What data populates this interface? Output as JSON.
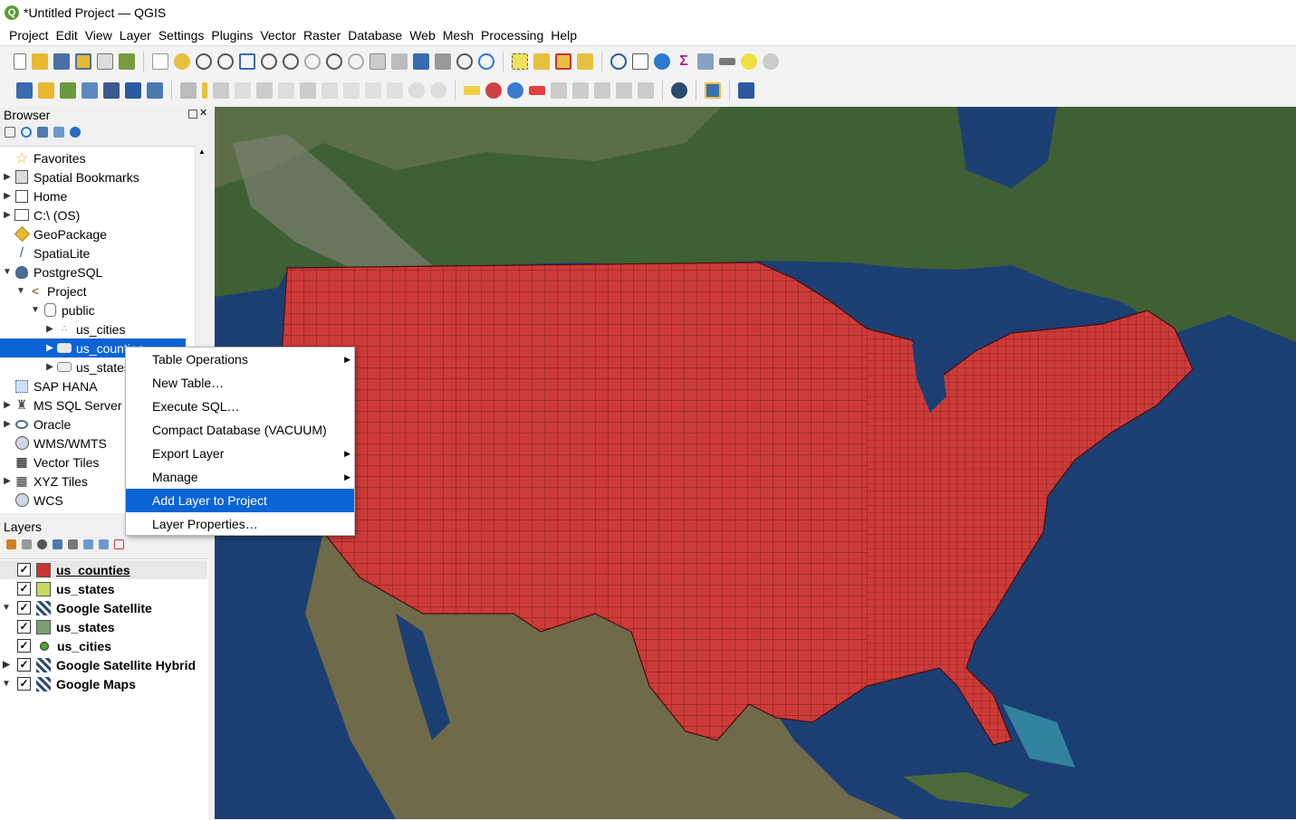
{
  "window": {
    "title": "*Untitled Project — QGIS",
    "logo": "Q"
  },
  "menu": [
    "Project",
    "Edit",
    "View",
    "Layer",
    "Settings",
    "Plugins",
    "Vector",
    "Raster",
    "Database",
    "Web",
    "Mesh",
    "Processing",
    "Help"
  ],
  "browser": {
    "title": "Browser",
    "items": [
      {
        "label": "Favorites",
        "icon": "star-icon",
        "arrow": ""
      },
      {
        "label": "Spatial Bookmarks",
        "icon": "bookmark-icon",
        "arrow": "▶"
      },
      {
        "label": "Home",
        "icon": "home-icon",
        "arrow": "▶"
      },
      {
        "label": "C:\\ (OS)",
        "icon": "folder-icon",
        "arrow": "▶"
      },
      {
        "label": "GeoPackage",
        "icon": "geopackage-icon",
        "arrow": ""
      },
      {
        "label": "SpatiaLite",
        "icon": "spatialite-icon",
        "arrow": ""
      },
      {
        "label": "PostgreSQL",
        "icon": "postgresql-icon",
        "arrow": "▼"
      },
      {
        "label": "Project",
        "icon": "connection-icon",
        "arrow": "▼"
      },
      {
        "label": "public",
        "icon": "schema-icon",
        "arrow": "▼"
      },
      {
        "label": "us_cities",
        "icon": "point-layer-icon",
        "arrow": "▶"
      },
      {
        "label": "us_counties",
        "icon": "polygon-layer-icon",
        "arrow": "▶"
      },
      {
        "label": "us_states",
        "icon": "polygon-layer-icon",
        "arrow": "▶"
      },
      {
        "label": "SAP HANA",
        "icon": "sap-hana-icon",
        "arrow": ""
      },
      {
        "label": "MS SQL Server",
        "icon": "mssql-icon",
        "arrow": "▶"
      },
      {
        "label": "Oracle",
        "icon": "oracle-icon",
        "arrow": "▶"
      },
      {
        "label": "WMS/WMTS",
        "icon": "globe-icon",
        "arrow": ""
      },
      {
        "label": "Vector Tiles",
        "icon": "grid-icon",
        "arrow": ""
      },
      {
        "label": "XYZ Tiles",
        "icon": "grid-icon",
        "arrow": "▶"
      },
      {
        "label": "WCS",
        "icon": "globe-icon",
        "arrow": ""
      }
    ]
  },
  "context_menu": {
    "items": [
      {
        "label": "Table Operations",
        "submenu": "▶"
      },
      {
        "label": "New Table…",
        "submenu": ""
      },
      {
        "label": "Execute SQL…",
        "submenu": ""
      },
      {
        "label": "Compact Database (VACUUM)",
        "submenu": ""
      },
      {
        "label": "Export Layer",
        "submenu": "▶"
      },
      {
        "label": "Manage",
        "submenu": "▶"
      },
      {
        "label": "Add Layer to Project",
        "submenu": ""
      },
      {
        "label": "Layer Properties…",
        "submenu": ""
      }
    ]
  },
  "layers": {
    "title": "Layers",
    "items": [
      {
        "label": "us_counties",
        "checked": "✓",
        "color": "#cc3333",
        "arrow": ""
      },
      {
        "label": "us_states",
        "checked": "✓",
        "color": "#c8d860",
        "arrow": ""
      },
      {
        "label": "Google Satellite",
        "checked": "✓",
        "color": "",
        "arrow": "▼"
      },
      {
        "label": "us_states",
        "checked": "✓",
        "color": "#7aa070",
        "arrow": ""
      },
      {
        "label": "us_cities",
        "checked": "✓",
        "color": "#5a9a3a",
        "arrow": ""
      },
      {
        "label": "Google Satellite Hybrid",
        "checked": "✓",
        "color": "",
        "arrow": "▶"
      },
      {
        "label": "Google Maps",
        "checked": "✓",
        "color": "",
        "arrow": "▼"
      }
    ]
  },
  "colors": {
    "selection": "#0a64d6",
    "counties": "#cc3b39",
    "ocean": "#1c3f73",
    "land": "#3f5f34"
  }
}
